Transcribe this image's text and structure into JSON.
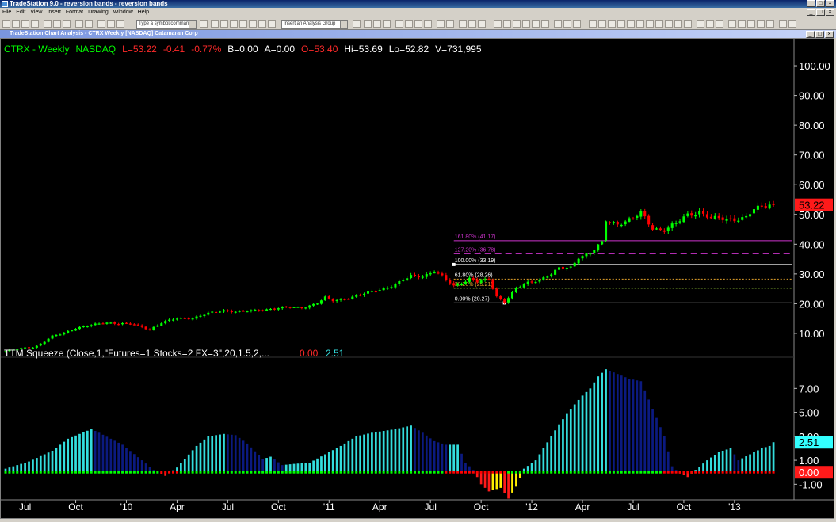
{
  "window": {
    "title": "TradeStation 9.0 - reversion bands - reversion bands"
  },
  "menu": [
    "File",
    "Edit",
    "View",
    "Insert",
    "Format",
    "Drawing",
    "Window",
    "Help"
  ],
  "toolbar": {
    "symbol_placeholder": "Type a symbol/command",
    "analysis_group": "Insert an Analysis Group"
  },
  "chart_window": {
    "title": "TradeStation Chart Analysis - CTRX Weekly [NASDAQ] Catamaran Corp"
  },
  "colors": {
    "background": "#000000",
    "up": "#00ff00",
    "down": "#ff0000",
    "fib_magenta": "#cc33cc",
    "hist_cyan": "#33dddd",
    "hist_navy": "#0b1a80",
    "hist_red": "#ff1a1a",
    "hist_yellow": "#ffee00"
  },
  "chart_data": [
    {
      "type": "candlestick",
      "header": {
        "symbol": "CTRX - Weekly",
        "exchange": "NASDAQ",
        "last": "L=53.22",
        "change": "-0.41",
        "change_pct": "-0.77%",
        "bid": "B=0.00",
        "ask": "A=0.00",
        "open": "O=53.40",
        "high": "Hi=53.69",
        "low": "Lo=52.82",
        "volume": "V=731,995"
      },
      "ylim": [
        2,
        108
      ],
      "y_ticks": [
        "100.00",
        "90.00",
        "80.00",
        "70.00",
        "60.00",
        "50.00",
        "40.00",
        "30.00",
        "20.00",
        "10.00"
      ],
      "last_price_label": "53.22",
      "x_ticks": [
        "Jul",
        "Oct",
        "'10",
        "Apr",
        "Jul",
        "Oct",
        "'11",
        "Apr",
        "Jul",
        "Oct",
        "'12",
        "Apr",
        "Jul",
        "Oct",
        "'13"
      ],
      "x_tick_weeks": [
        5,
        18,
        31,
        44,
        57,
        70,
        83,
        96,
        109,
        122,
        135,
        148,
        161,
        174,
        187
      ],
      "weeks": 198,
      "closes": [
        {
          "w": 0,
          "c": 4.0
        },
        {
          "w": 4,
          "c": 4.9
        },
        {
          "w": 8,
          "c": 5.8
        },
        {
          "w": 12,
          "c": 8.9
        },
        {
          "w": 15,
          "c": 10.2
        },
        {
          "w": 18,
          "c": 11.9
        },
        {
          "w": 22,
          "c": 12.7
        },
        {
          "w": 26,
          "c": 13.7
        },
        {
          "w": 30,
          "c": 13.3
        },
        {
          "w": 33,
          "c": 12.9
        },
        {
          "w": 37,
          "c": 11.4
        },
        {
          "w": 40,
          "c": 13.6
        },
        {
          "w": 44,
          "c": 15.0
        },
        {
          "w": 48,
          "c": 15.2
        },
        {
          "w": 52,
          "c": 16.7
        },
        {
          "w": 56,
          "c": 17.8
        },
        {
          "w": 60,
          "c": 17.3
        },
        {
          "w": 64,
          "c": 17.7
        },
        {
          "w": 68,
          "c": 18.3
        },
        {
          "w": 72,
          "c": 18.8
        },
        {
          "w": 76,
          "c": 18.7
        },
        {
          "w": 80,
          "c": 20.2
        },
        {
          "w": 82,
          "c": 22.0
        },
        {
          "w": 84,
          "c": 21.0
        },
        {
          "w": 88,
          "c": 22.0
        },
        {
          "w": 92,
          "c": 23.3
        },
        {
          "w": 96,
          "c": 24.8
        },
        {
          "w": 100,
          "c": 26.4
        },
        {
          "w": 104,
          "c": 29.3
        },
        {
          "w": 107,
          "c": 29.4
        },
        {
          "w": 110,
          "c": 30.8
        },
        {
          "w": 112,
          "c": 29.0
        },
        {
          "w": 115,
          "c": 26.0
        },
        {
          "w": 117,
          "c": 27.0
        },
        {
          "w": 119,
          "c": 28.5
        },
        {
          "w": 121,
          "c": 27.3
        },
        {
          "w": 124,
          "c": 28.0
        },
        {
          "w": 126,
          "c": 22.5
        },
        {
          "w": 128,
          "c": 20.7
        },
        {
          "w": 131,
          "c": 25.0
        },
        {
          "w": 134,
          "c": 27.0
        },
        {
          "w": 137,
          "c": 28.2
        },
        {
          "w": 140,
          "c": 30.0
        },
        {
          "w": 142,
          "c": 31.8
        },
        {
          "w": 145,
          "c": 32.2
        },
        {
          "w": 147,
          "c": 35.8
        },
        {
          "w": 150,
          "c": 37.0
        },
        {
          "w": 153,
          "c": 40.4
        },
        {
          "w": 154,
          "c": 48.0
        },
        {
          "w": 157,
          "c": 47.0
        },
        {
          "w": 161,
          "c": 48.5
        },
        {
          "w": 163,
          "c": 50.5
        },
        {
          "w": 166,
          "c": 45.5
        },
        {
          "w": 169,
          "c": 44.8
        },
        {
          "w": 172,
          "c": 46.8
        },
        {
          "w": 175,
          "c": 50.0
        },
        {
          "w": 178,
          "c": 51.0
        },
        {
          "w": 181,
          "c": 48.5
        },
        {
          "w": 184,
          "c": 48.5
        },
        {
          "w": 187,
          "c": 48.5
        },
        {
          "w": 190,
          "c": 49.0
        },
        {
          "w": 192,
          "c": 51.5
        },
        {
          "w": 194,
          "c": 52.5
        },
        {
          "w": 196,
          "c": 53.6
        },
        {
          "w": 197,
          "c": 53.22
        }
      ],
      "fib_levels": [
        {
          "label": "161.80% (41.17)",
          "value": 41.17
        },
        {
          "label": "127.20% (36.78)",
          "value": 36.78
        },
        {
          "label": "100.00% (33.19)",
          "value": 33.19
        },
        {
          "label": "61.80% (28.26)",
          "value": 28.26
        },
        {
          "label": "38.20% (25.21)",
          "value": 25.21
        },
        {
          "label": "0.00% (20.27)",
          "value": 20.27
        }
      ],
      "fib_start_week": 115
    },
    {
      "type": "bar",
      "name": "TTM Squeeze",
      "label": "TTM Squeeze (Close,1,\"Futures=1 Stocks=2 FX=3\",20,1.5,2,...",
      "value1": "0.00",
      "value2": "2.51",
      "ylim": [
        -2.3,
        9.6
      ],
      "y_ticks": [
        "7.00",
        "5.00",
        "3.00",
        "1.00",
        "-1.00"
      ],
      "y_tick_values": [
        7,
        5,
        3,
        1,
        -1
      ],
      "last_labels": [
        "2.51",
        "0.00"
      ],
      "hist_points": [
        {
          "w": 0,
          "v": 0.3
        },
        {
          "w": 6,
          "v": 0.9
        },
        {
          "w": 12,
          "v": 1.8
        },
        {
          "w": 16,
          "v": 2.8
        },
        {
          "w": 22,
          "v": 3.6
        },
        {
          "w": 24,
          "v": 3.3
        },
        {
          "w": 30,
          "v": 2.3
        },
        {
          "w": 35,
          "v": 1.0
        },
        {
          "w": 38,
          "v": 0.2
        },
        {
          "w": 41,
          "v": -0.3
        },
        {
          "w": 44,
          "v": 0.4
        },
        {
          "w": 49,
          "v": 2.2
        },
        {
          "w": 52,
          "v": 3.0
        },
        {
          "w": 56,
          "v": 3.2
        },
        {
          "w": 59,
          "v": 3.1
        },
        {
          "w": 62,
          "v": 2.4
        },
        {
          "w": 66,
          "v": 1.1
        },
        {
          "w": 68,
          "v": 1.3
        },
        {
          "w": 71,
          "v": 0.6
        },
        {
          "w": 74,
          "v": 0.7
        },
        {
          "w": 78,
          "v": 0.8
        },
        {
          "w": 82,
          "v": 1.5
        },
        {
          "w": 86,
          "v": 2.2
        },
        {
          "w": 90,
          "v": 3.0
        },
        {
          "w": 94,
          "v": 3.3
        },
        {
          "w": 100,
          "v": 3.6
        },
        {
          "w": 104,
          "v": 3.9
        },
        {
          "w": 107,
          "v": 3.3
        },
        {
          "w": 110,
          "v": 2.6
        },
        {
          "w": 113,
          "v": 2.3
        },
        {
          "w": 116,
          "v": 2.3
        },
        {
          "w": 118,
          "v": 0.8
        },
        {
          "w": 120,
          "v": 0.2
        },
        {
          "w": 122,
          "v": -1.0
        },
        {
          "w": 124,
          "v": -1.6
        },
        {
          "w": 127,
          "v": -1.3
        },
        {
          "w": 129,
          "v": -2.2
        },
        {
          "w": 131,
          "v": -1.2
        },
        {
          "w": 133,
          "v": 0.3
        },
        {
          "w": 136,
          "v": 1.0
        },
        {
          "w": 139,
          "v": 2.5
        },
        {
          "w": 142,
          "v": 4.0
        },
        {
          "w": 145,
          "v": 5.3
        },
        {
          "w": 148,
          "v": 6.4
        },
        {
          "w": 150,
          "v": 7.0
        },
        {
          "w": 152,
          "v": 8.0
        },
        {
          "w": 154,
          "v": 8.6
        },
        {
          "w": 157,
          "v": 8.2
        },
        {
          "w": 160,
          "v": 7.8
        },
        {
          "w": 163,
          "v": 7.6
        },
        {
          "w": 166,
          "v": 5.3
        },
        {
          "w": 169,
          "v": 3.0
        },
        {
          "w": 171,
          "v": 0.5
        },
        {
          "w": 173,
          "v": -0.1
        },
        {
          "w": 175,
          "v": -0.4
        },
        {
          "w": 177,
          "v": 0.2
        },
        {
          "w": 180,
          "v": 1.0
        },
        {
          "w": 183,
          "v": 1.7
        },
        {
          "w": 186,
          "v": 2.0
        },
        {
          "w": 188,
          "v": 1.0
        },
        {
          "w": 191,
          "v": 1.5
        },
        {
          "w": 194,
          "v": 2.0
        },
        {
          "w": 196,
          "v": 2.2
        },
        {
          "w": 197,
          "v": 2.51
        }
      ],
      "squeeze_on_ranges": [
        [
          40,
          44
        ],
        [
          113,
          128
        ],
        [
          169,
          197
        ]
      ]
    }
  ]
}
